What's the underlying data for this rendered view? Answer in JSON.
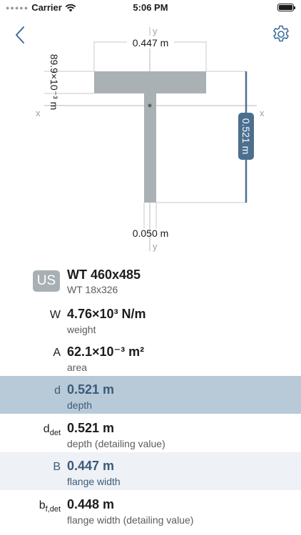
{
  "status_bar": {
    "carrier": "Carrier",
    "time": "5:06 PM"
  },
  "nav": {
    "back_icon": "chevron-left-icon",
    "settings_icon": "gear-icon",
    "accent_color": "#3b6d9c"
  },
  "diagram": {
    "flange_width_label": "0.447 m",
    "flange_thickness_label": "89.9×10⁻³ m",
    "depth_label": "0.521 m",
    "web_thickness_label": "0.050 m",
    "x_axis_label": "x",
    "y_axis_label": "y",
    "section_color": "#a9b1b5",
    "highlight_color": "#4b6f8f"
  },
  "section": {
    "system": "US",
    "name": "WT 460x485",
    "alt_name": "WT 18x326"
  },
  "properties": [
    {
      "symbol": "W",
      "subscript": "",
      "value": "4.76×10³ N/m",
      "description": "weight",
      "state": "normal"
    },
    {
      "symbol": "A",
      "subscript": "",
      "value": "62.1×10⁻³ m²",
      "description": "area",
      "state": "normal"
    },
    {
      "symbol": "d",
      "subscript": "",
      "value": "0.521 m",
      "description": "depth",
      "state": "selected"
    },
    {
      "symbol": "d",
      "subscript": "det",
      "value": "0.521 m",
      "description": "depth (detailing value)",
      "state": "normal"
    },
    {
      "symbol": "B",
      "subscript": "",
      "value": "0.447 m",
      "description": "flange width",
      "state": "shaded"
    },
    {
      "symbol": "b",
      "subscript": "f,det",
      "value": "0.448 m",
      "description": "flange width (detailing value)",
      "state": "normal"
    }
  ]
}
